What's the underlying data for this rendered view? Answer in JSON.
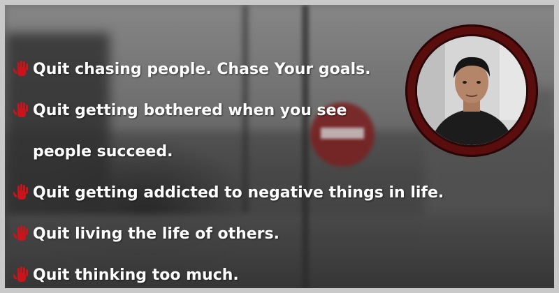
{
  "quotes": [
    "Quit chasing people. Chase Your goals.",
    "Quit getting bothered when you see people succeed.",
    "Quit getting addicted to negative things in life.",
    "Quit living the life of others.",
    "Quit thinking too much."
  ],
  "colors": {
    "hand_icon": "#c8141a",
    "text": "#ffffff",
    "avatar_ring": "#5a0d0d",
    "frame_border": "#c9c9c9"
  },
  "icons": [
    "hand-icon"
  ]
}
